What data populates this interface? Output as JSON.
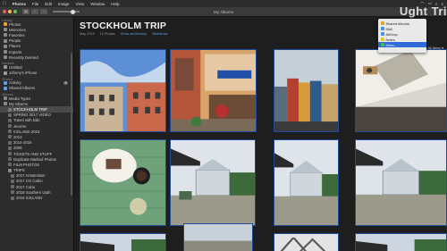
{
  "menubar": {
    "apple": "",
    "app": "Photos",
    "items": [
      "File",
      "Edit",
      "Image",
      "View",
      "Window",
      "Help"
    ]
  },
  "window": {
    "title": "My Albums"
  },
  "watermark": "Ught Tri",
  "sidebar": {
    "sections": [
      {
        "header": "Library",
        "items": [
          {
            "label": "Photos",
            "color": "#f0a030"
          },
          {
            "label": "Memories",
            "color": "#8a8a8a"
          },
          {
            "label": "Favorites",
            "color": "#8a8a8a"
          },
          {
            "label": "People",
            "color": "#8a8a8a"
          },
          {
            "label": "Places",
            "color": "#8a8a8a"
          },
          {
            "label": "Imports",
            "color": "#8a8a8a"
          },
          {
            "label": "Recently Deleted",
            "color": "#8a8a8a"
          }
        ]
      },
      {
        "header": "Devices",
        "items": [
          {
            "label": "Untitled",
            "color": "#9a9a9a"
          },
          {
            "label": "Johnny's iPhone",
            "color": "#9a9a9a"
          }
        ]
      },
      {
        "header": "Shared",
        "items": [
          {
            "label": "Activity",
            "color": "#5aa0e6",
            "badge": "9"
          },
          {
            "label": "Shared Albums",
            "color": "#5aa0e6"
          }
        ]
      },
      {
        "header": "Albums",
        "items": [
          {
            "label": "Media Types",
            "color": "#8a8a8a"
          },
          {
            "label": "My Albums",
            "color": "#8a8a8a"
          }
        ]
      }
    ],
    "albums": [
      {
        "label": "STOCKHOLM TRIP",
        "selected": true
      },
      {
        "label": "SPRING 2017 VIDEO"
      },
      {
        "label": "Travel with kids"
      },
      {
        "label": "Jerome"
      },
      {
        "label": "ICELAND 2015"
      },
      {
        "label": "2013"
      },
      {
        "label": "2014-2016"
      },
      {
        "label": "2009"
      },
      {
        "label": "TICKETS AND STUFF"
      },
      {
        "label": "Duplicate Marked Photos"
      },
      {
        "label": "FILM PHOTOS"
      }
    ],
    "trips_folder": "TRIPS",
    "trips": [
      "2017 Amsterdam",
      "2017 CO Cabin",
      "2017 Cuba",
      "2018 Southern Utah",
      "2018 ICELAND"
    ]
  },
  "main": {
    "title": "STOCKHOLM TRIP",
    "date": "May 2019",
    "count": "12 Photos",
    "show_memory": "Show as Memory",
    "slideshow": "Slideshow",
    "all_items": "All Items ▾"
  },
  "share_menu": {
    "items": [
      {
        "label": "Shared Albums",
        "color": "#e6a020"
      },
      {
        "label": "Mail",
        "color": "#4a8ee8"
      },
      {
        "label": "AirDrop",
        "color": "#4a8ee8"
      },
      {
        "label": "Notes",
        "color": "#e8c830"
      },
      {
        "label": "Mess...",
        "color": "#3fbf50",
        "highlight": true
      }
    ]
  },
  "photos": [
    {
      "name": "photo-blue-building"
    },
    {
      "name": "photo-orange-storefront"
    },
    {
      "name": "photo-gamla-stan-square"
    },
    {
      "name": "photo-ceiling-crowd"
    },
    {
      "name": "photo-cake-coffee"
    },
    {
      "name": "photo-greenhouse-1"
    },
    {
      "name": "photo-greenhouse-2"
    },
    {
      "name": "photo-greenhouse-3"
    },
    {
      "name": "photo-bottom-1"
    },
    {
      "name": "photo-bottom-2"
    },
    {
      "name": "photo-bottom-3"
    },
    {
      "name": "photo-bottom-4"
    }
  ]
}
